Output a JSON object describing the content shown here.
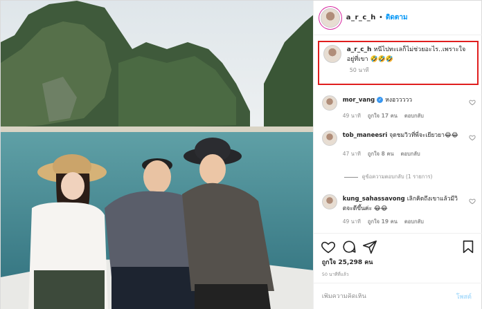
{
  "header": {
    "username": "a_r_c_h",
    "separator": "•",
    "follow_label": "ติดตาม"
  },
  "caption": {
    "username": "a_r_c_h",
    "text": "หนีไปทะเลก็ไม่ช่วยอะไร..เพราะใจอยู่ที่เขา 🤣🤣🤣",
    "time": "50 นาที"
  },
  "comments": [
    {
      "username": "mor_vang",
      "verified": true,
      "verified_mark": "✓",
      "text": "หงอววววว",
      "time": "49 นาที",
      "likes": "ถูกใจ 17 คน",
      "reply": "ตอบกลับ"
    },
    {
      "username": "tob_maneesri",
      "verified": false,
      "text": "จุดชมวิวที่พี่จะเยียวยา😂😂",
      "time": "47 นาที",
      "likes": "ถูกใจ 8 คน",
      "reply": "ตอบกลับ"
    },
    {
      "username": "kung_sahassavong",
      "verified": false,
      "text": "เลิกคิดถึงเขาแล้วมีวิตจะดีขึ้นค่ะ 😂😂",
      "time": "49 นาที",
      "likes": "ถูกใจ 19 คน",
      "reply": "ตอบกลับ"
    }
  ],
  "view_replies": "ดูข้อความตอบกลับ (1 รายการ)",
  "actions": {
    "like_icon": "heart-icon",
    "comment_icon": "comment-icon",
    "share_icon": "share-icon",
    "save_icon": "bookmark-icon"
  },
  "likes_count": "ถูกใจ 25,298 คน",
  "post_time": "50 นาทีที่แล้ว",
  "add_comment": {
    "placeholder": "เพิ่มความคิดเห็น",
    "post_label": "โพสต์"
  },
  "colors": {
    "link_blue": "#0095f6",
    "highlight_red": "#e01e1e",
    "muted": "#8e8e8e"
  }
}
